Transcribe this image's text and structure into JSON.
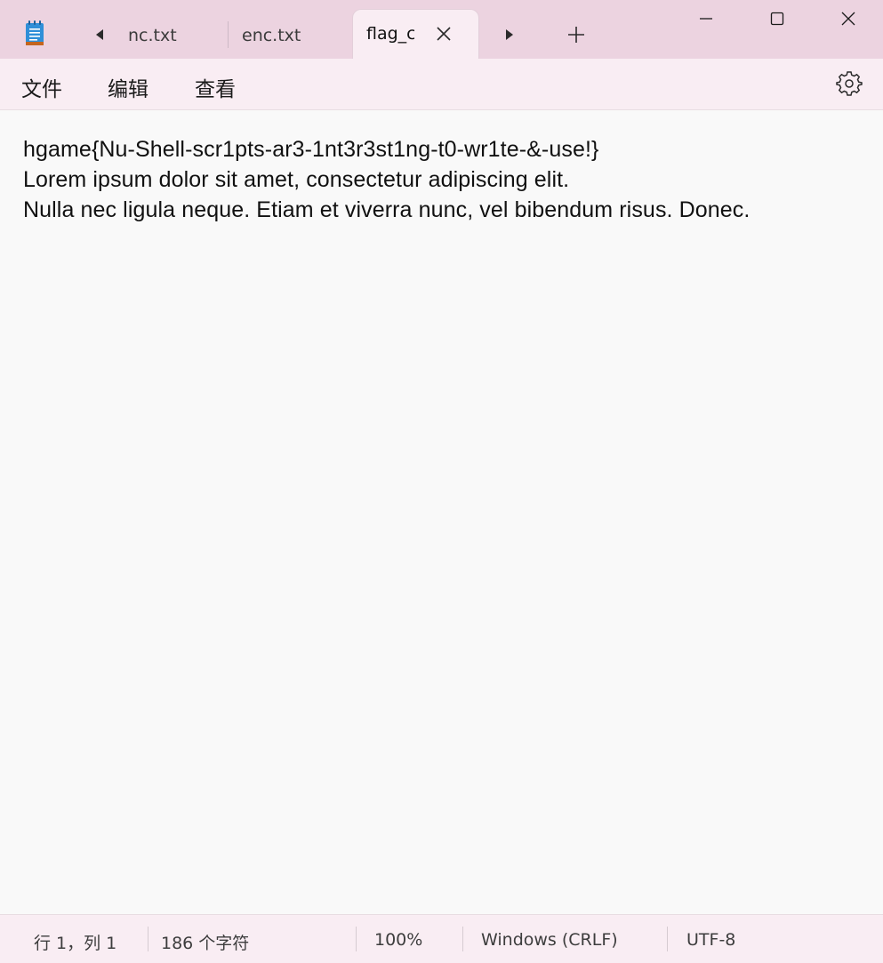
{
  "titlebar": {
    "app_icon": "notepad-icon",
    "tabs": [
      {
        "label": "nc.txt"
      },
      {
        "label": "enc.txt"
      },
      {
        "label": "flag_c",
        "active": true
      }
    ],
    "scroll_left_icon": "caret-left-icon",
    "scroll_right_icon": "caret-right-icon",
    "new_tab_icon": "plus-icon",
    "window_controls": [
      "minimize-icon",
      "maximize-icon",
      "close-icon"
    ]
  },
  "menubar": {
    "file": "文件",
    "edit": "编辑",
    "view": "查看",
    "settings_icon": "gear-icon"
  },
  "editor": {
    "lines": [
      "hgame{Nu-Shell-scr1pts-ar3-1nt3r3st1ng-t0-wr1te-&-use!}",
      "Lorem ipsum dolor sit amet, consectetur adipiscing elit.",
      "Nulla nec ligula neque. Etiam et viverra nunc, vel bibendum risus. Donec."
    ]
  },
  "statusbar": {
    "position": "行 1，列 1",
    "char_count": "186 个字符",
    "zoom": "100%",
    "line_ending": "Windows (CRLF)",
    "encoding": "UTF-8"
  },
  "colors": {
    "titlebar_bg": "#ecd3e0",
    "chrome_bg": "#f9edf3",
    "editor_bg": "#f9f9f9",
    "app_icon_accent": "#2f8fd8"
  }
}
